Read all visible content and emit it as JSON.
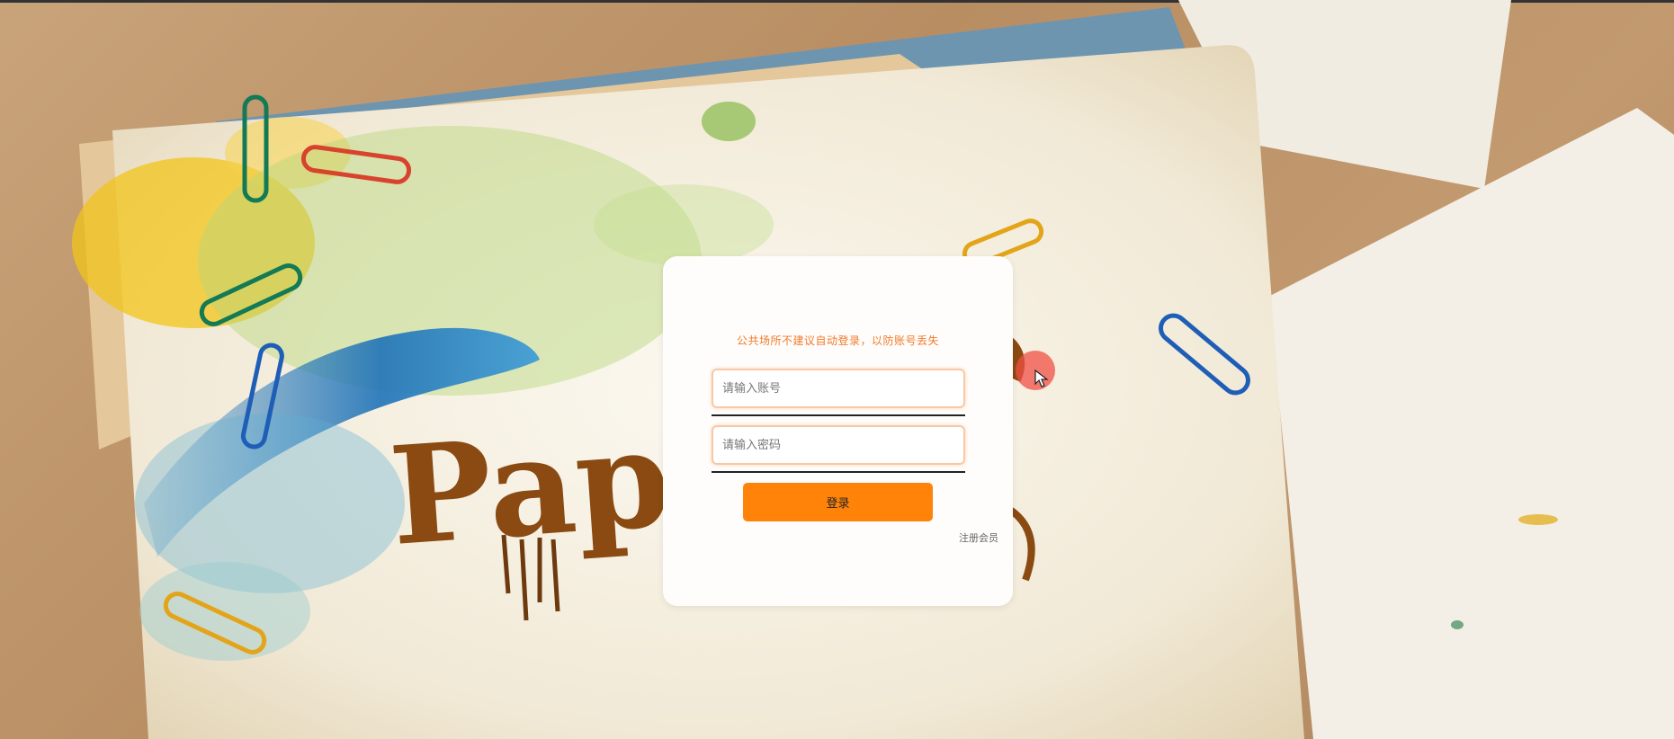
{
  "background": {
    "logo_text": "Pape",
    "colors": {
      "desk": "#c39a70",
      "paper": "#f3ecd9",
      "logo": "#8a4a12"
    }
  },
  "login": {
    "notice": "公共场所不建议自动登录，以防账号丢失",
    "account_placeholder": "请输入账号",
    "password_placeholder": "请输入密码",
    "login_label": "登录",
    "register_label": "注册会员",
    "colors": {
      "accent": "#ff8309",
      "notice": "#f07a2a"
    }
  },
  "icons": {
    "cursor": "cursor-arrow-icon"
  }
}
